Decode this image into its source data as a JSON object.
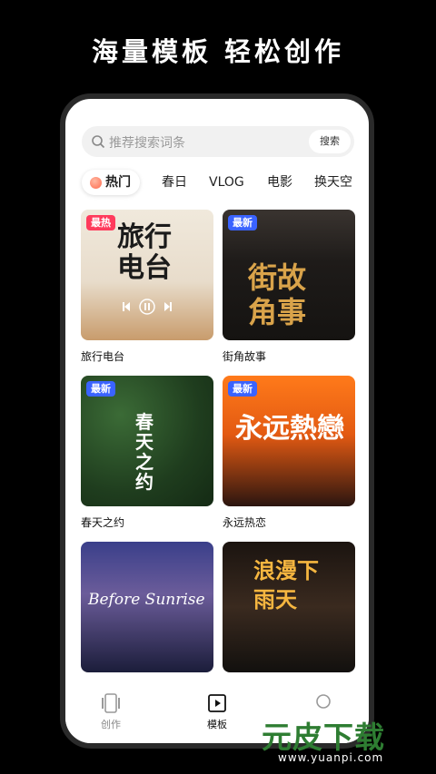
{
  "headline": "海量模板 轻松创作",
  "search": {
    "placeholder": "推荐搜索词条",
    "button": "搜索"
  },
  "tabs": [
    "热门",
    "春日",
    "VLOG",
    "电影",
    "换天空"
  ],
  "cards": [
    {
      "title": "旅行电台",
      "badge": "最热",
      "badge_color": "#ff3b5c",
      "art_text": "旅行\n电台"
    },
    {
      "title": "街角故事",
      "badge": "最新",
      "badge_color": "#3a63ff",
      "art_text": "街故\n角事"
    },
    {
      "title": "春天之约",
      "badge": "最新",
      "badge_color": "#3a63ff",
      "art_text": "春天之约"
    },
    {
      "title": "永远热恋",
      "badge": "最新",
      "badge_color": "#3a63ff",
      "art_text": "永远熱戀"
    },
    {
      "title": "",
      "badge": "",
      "badge_color": "",
      "art_text": "Before Sunrise"
    },
    {
      "title": "",
      "badge": "",
      "badge_color": "",
      "art_text": "浪漫下雨天"
    }
  ],
  "bottom_nav": [
    {
      "label": "创作",
      "icon": "phone-frame-icon"
    },
    {
      "label": "模板",
      "icon": "play-square-icon"
    },
    {
      "label": "",
      "icon": "circle-icon"
    }
  ],
  "watermark": {
    "text": "元皮下载",
    "url": "www.yuanpi.com"
  }
}
